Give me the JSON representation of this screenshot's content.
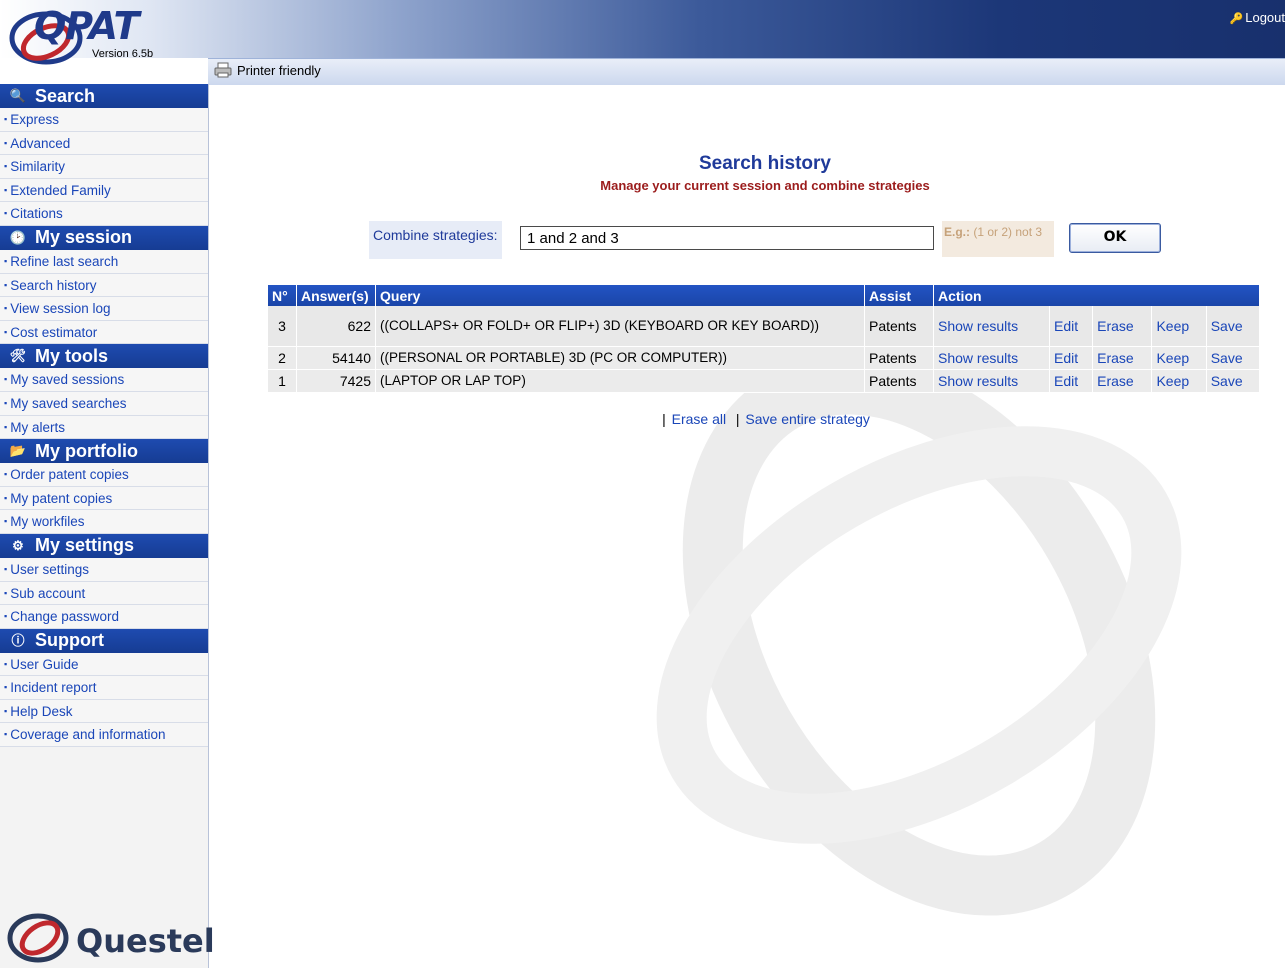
{
  "header": {
    "logo_text": "QPAT",
    "version": "Version 6.5b",
    "logout": "Logout",
    "printer_friendly": "Printer friendly"
  },
  "sidebar": {
    "sections": [
      {
        "title": "Search",
        "icon": "search-icon",
        "items": [
          "Express",
          "Advanced",
          "Similarity",
          "Extended Family",
          "Citations"
        ]
      },
      {
        "title": "My session",
        "icon": "session-icon",
        "items": [
          "Refine last search",
          "Search history",
          "View session log",
          "Cost estimator"
        ]
      },
      {
        "title": "My tools",
        "icon": "tools-icon",
        "items": [
          "My saved sessions",
          "My saved searches",
          "My alerts"
        ]
      },
      {
        "title": "My portfolio",
        "icon": "folder-icon",
        "items": [
          "Order patent copies",
          "My patent copies",
          "My workfiles"
        ]
      },
      {
        "title": "My settings",
        "icon": "settings-icon",
        "items": [
          "User settings",
          "Sub account",
          "Change password"
        ]
      },
      {
        "title": "Support",
        "icon": "support-icon",
        "items": [
          "User Guide",
          "Incident report",
          "Help Desk",
          "Coverage and information"
        ]
      }
    ],
    "footer_logo": "Questel"
  },
  "main": {
    "title": "Search history",
    "subtitle": "Manage your current session and combine strategies",
    "combine_label": "Combine strategies:",
    "combine_value": "1 and 2 and 3",
    "example_prefix": "E.g.:",
    "example_text": " (1 or 2) not 3",
    "ok_label": "OK",
    "table": {
      "headers": [
        "N°",
        "Answer(s)",
        "Query",
        "Assist",
        "Action"
      ],
      "rows": [
        {
          "n": "3",
          "answers": "622",
          "query": "((COLLAPS+ OR FOLD+ OR FLIP+) 3D (KEYBOARD OR KEY BOARD))",
          "assist": "Patents",
          "actions": [
            "Show results",
            "Edit",
            "Erase",
            "Keep",
            "Save"
          ]
        },
        {
          "n": "2",
          "answers": "54140",
          "query": "((PERSONAL OR PORTABLE) 3D (PC OR COMPUTER))",
          "assist": "Patents",
          "actions": [
            "Show results",
            "Edit",
            "Erase",
            "Keep",
            "Save"
          ]
        },
        {
          "n": "1",
          "answers": "7425",
          "query": "(LAPTOP OR LAP TOP)",
          "assist": "Patents",
          "actions": [
            "Show results",
            "Edit",
            "Erase",
            "Keep",
            "Save"
          ]
        }
      ]
    },
    "erase_all": "Erase all",
    "save_strategy": "Save entire strategy"
  }
}
